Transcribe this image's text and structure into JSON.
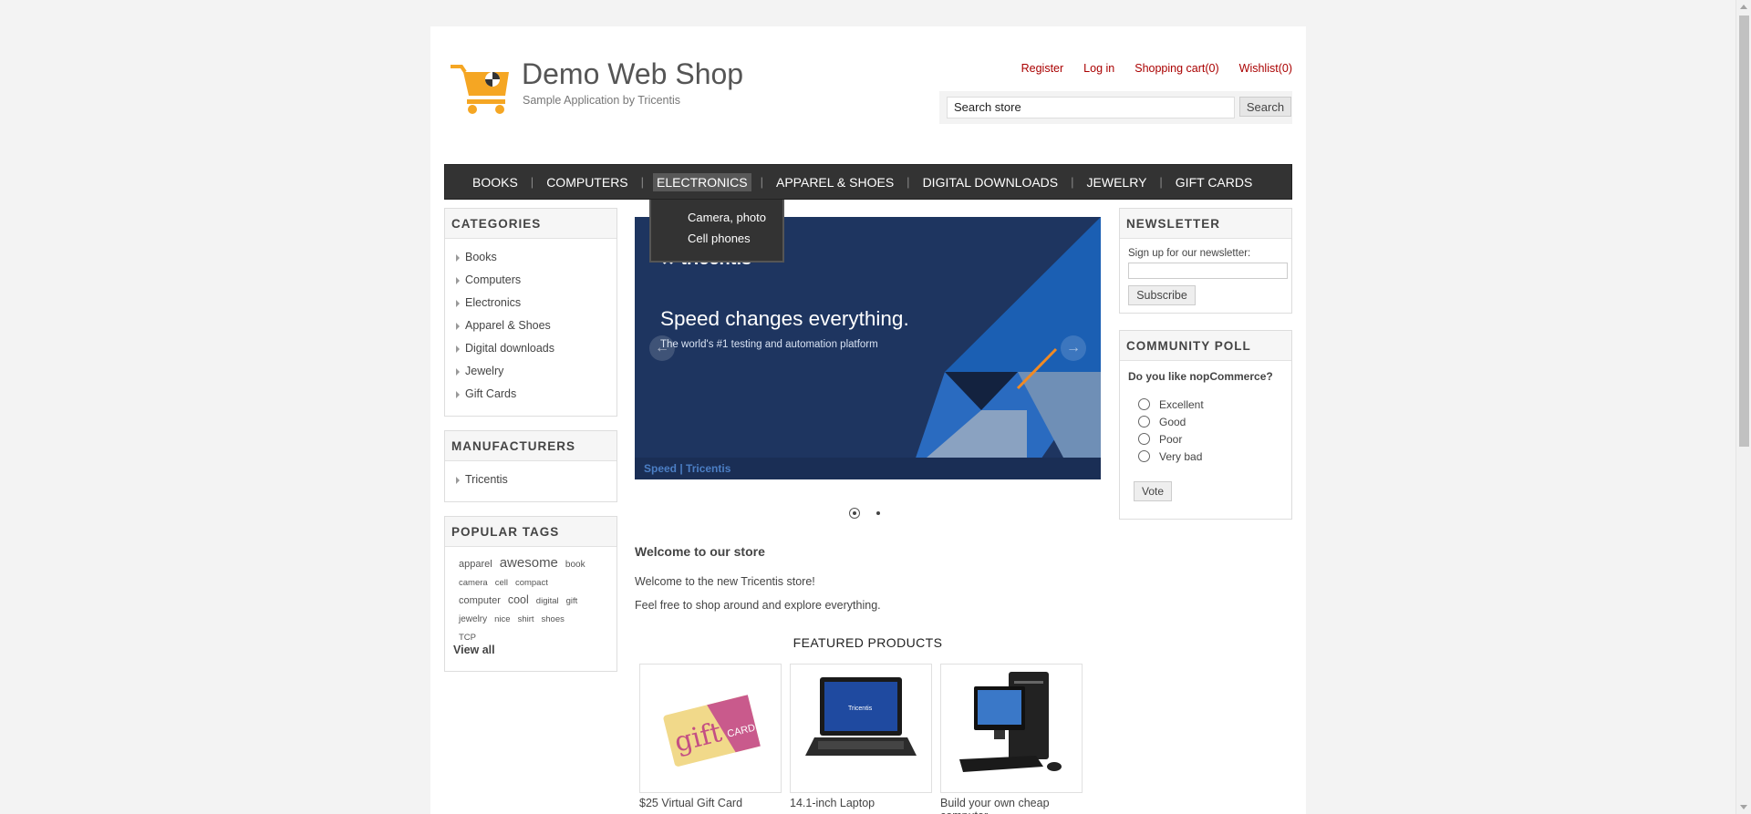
{
  "header": {
    "title": "Demo Web Shop",
    "subtitle": "Sample Application by Tricentis",
    "links": [
      "Register",
      "Log in",
      "Shopping cart(0)",
      "Wishlist(0)"
    ],
    "search_value": "Search store",
    "search_button": "Search"
  },
  "menu": {
    "items": [
      "BOOKS",
      "COMPUTERS",
      "ELECTRONICS",
      "APPAREL & SHOES",
      "DIGITAL DOWNLOADS",
      "JEWELRY",
      "GIFT CARDS"
    ],
    "submenu": [
      "Camera, photo",
      "Cell phones"
    ]
  },
  "categories": {
    "title": "CATEGORIES",
    "items": [
      "Books",
      "Computers",
      "Electronics",
      "Apparel & Shoes",
      "Digital downloads",
      "Jewelry",
      "Gift Cards"
    ]
  },
  "manufacturers": {
    "title": "MANUFACTURERS",
    "items": [
      "Tricentis"
    ]
  },
  "tags": {
    "title": "POPULAR TAGS",
    "items": [
      "apparel",
      "awesome",
      "book",
      "camera",
      "cell",
      "compact",
      "computer",
      "cool",
      "digital",
      "gift",
      "jewelry",
      "nice",
      "shirt",
      "shoes",
      "TCP"
    ],
    "view_all": "View all"
  },
  "slider": {
    "logo": "✖ tricentis",
    "headline": "Speed changes everything.",
    "subline": "The world's #1 testing and automation platform",
    "footer": "Speed | Tricentis"
  },
  "welcome": {
    "title": "Welcome to our store",
    "p1": "Welcome to the new Tricentis store!",
    "p2": "Feel free to shop around and explore everything."
  },
  "featured": {
    "title": "FEATURED PRODUCTS",
    "products": [
      "$25 Virtual Gift Card",
      "14.1-inch Laptop",
      "Build your own cheap computer"
    ]
  },
  "newsletter": {
    "title": "NEWSLETTER",
    "label": "Sign up for our newsletter:",
    "button": "Subscribe"
  },
  "poll": {
    "title": "COMMUNITY POLL",
    "question": "Do you like nopCommerce?",
    "options": [
      "Excellent",
      "Good",
      "Poor",
      "Very bad"
    ],
    "button": "Vote"
  },
  "colors": {
    "link_red": "#a00000",
    "menu_bg": "#333333",
    "slider_bg": "#1e3560",
    "logo_orange": "#f5a623"
  }
}
